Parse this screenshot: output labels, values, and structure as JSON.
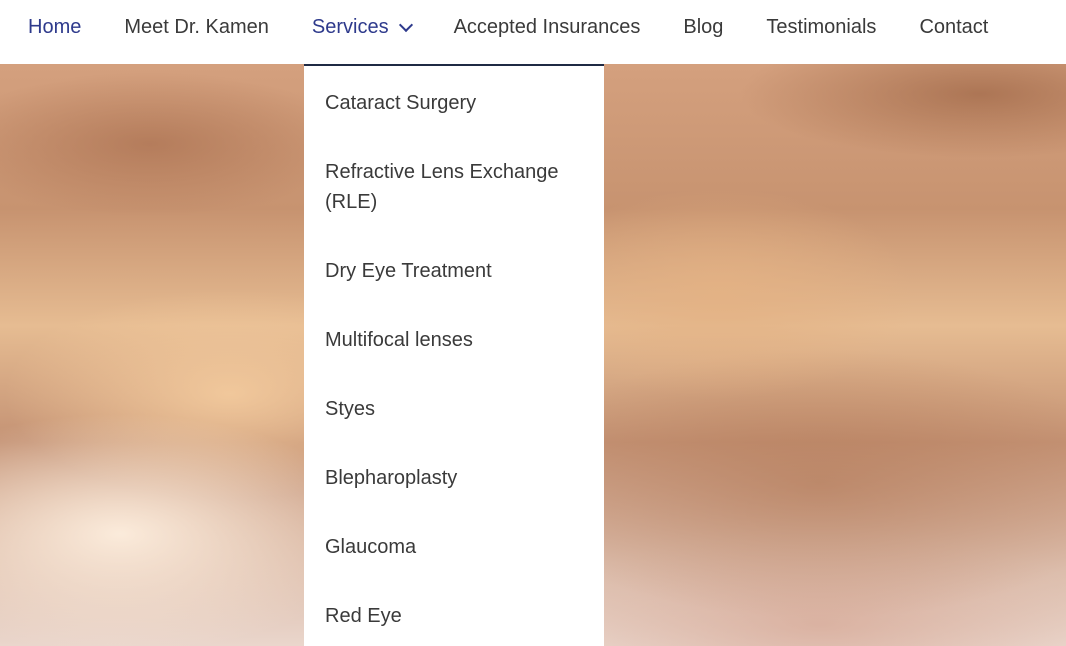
{
  "nav": {
    "items": [
      {
        "label": "Home"
      },
      {
        "label": "Meet Dr. Kamen"
      },
      {
        "label": "Services"
      },
      {
        "label": "Accepted Insurances"
      },
      {
        "label": "Blog"
      },
      {
        "label": "Testimonials"
      },
      {
        "label": "Contact"
      }
    ],
    "colors": {
      "active": "#2e3a8c",
      "text": "#3a3a3a"
    }
  },
  "services_menu": {
    "items": [
      {
        "label": "Cataract Surgery"
      },
      {
        "label": "Refractive Lens Exchange (RLE)"
      },
      {
        "label": "Dry Eye Treatment"
      },
      {
        "label": "Multifocal lenses"
      },
      {
        "label": "Styes"
      },
      {
        "label": "Blepharoplasty"
      },
      {
        "label": "Glaucoma"
      },
      {
        "label": "Red Eye"
      }
    ]
  }
}
